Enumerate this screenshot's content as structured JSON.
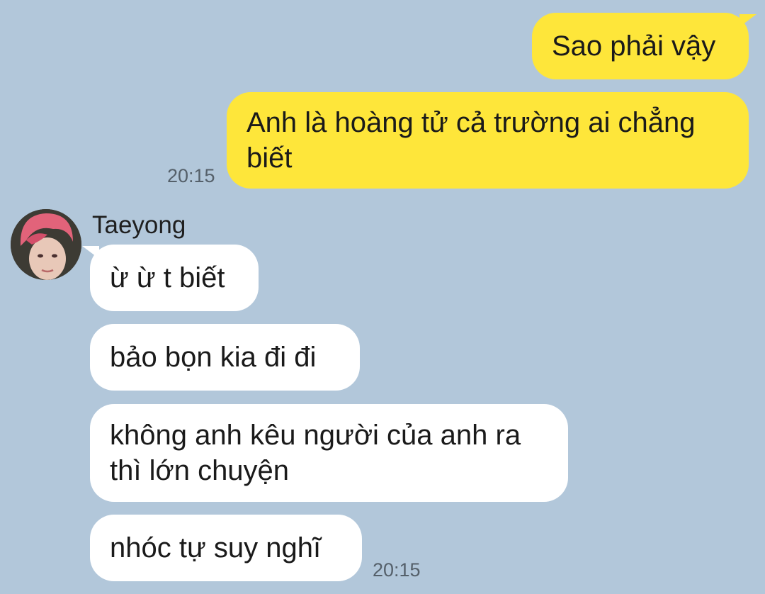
{
  "chat": {
    "outgoing": [
      {
        "text": "Sao phải vậy"
      },
      {
        "text": "Anh là hoàng tử cả trường ai chẳng biết"
      }
    ],
    "outgoing_time": "20:15",
    "sender": {
      "name": "Taeyong",
      "avatar_icon": "profile-photo"
    },
    "incoming": [
      {
        "text": "ừ ừ t biết"
      },
      {
        "text": "bảo bọn kia đi đi"
      },
      {
        "text": "không anh kêu người của anh ra thì lớn chuyện"
      },
      {
        "text": "nhóc tự suy nghĩ"
      }
    ],
    "incoming_time": "20:15"
  },
  "colors": {
    "background": "#b2c7da",
    "outgoing_bubble": "#fee63a",
    "incoming_bubble": "#ffffff"
  }
}
